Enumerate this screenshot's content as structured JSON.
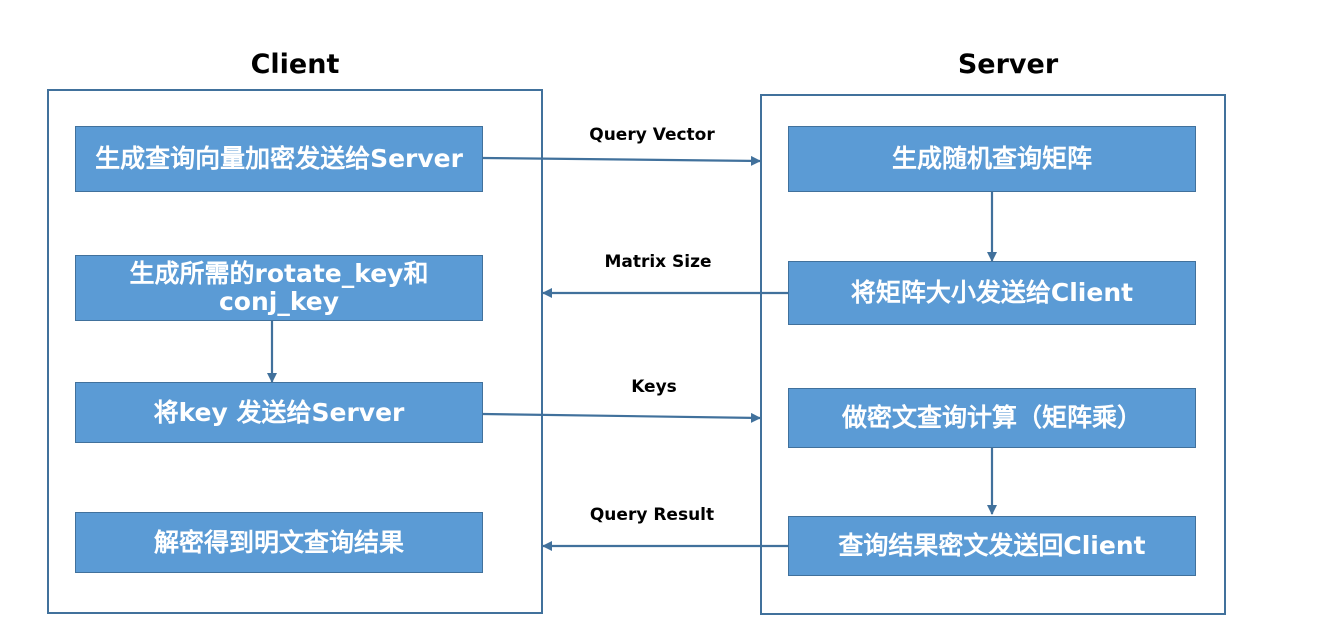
{
  "client": {
    "title": "Client",
    "steps": [
      "生成查询向量加密发送给Server",
      "生成所需的rotate_key和\nconj_key",
      "将key 发送给Server",
      "解密得到明文查询结果"
    ]
  },
  "server": {
    "title": "Server",
    "steps": [
      "生成随机查询矩阵",
      "将矩阵大小发送给Client",
      "做密文查询计算（矩阵乘）",
      "查询结果密文发送回Client"
    ]
  },
  "messages": [
    "Query Vector",
    "Matrix Size",
    "Keys",
    "Query Result"
  ],
  "colors": {
    "box_fill": "#5b9bd5",
    "box_border": "#41719c",
    "arrow": "#41719c"
  }
}
